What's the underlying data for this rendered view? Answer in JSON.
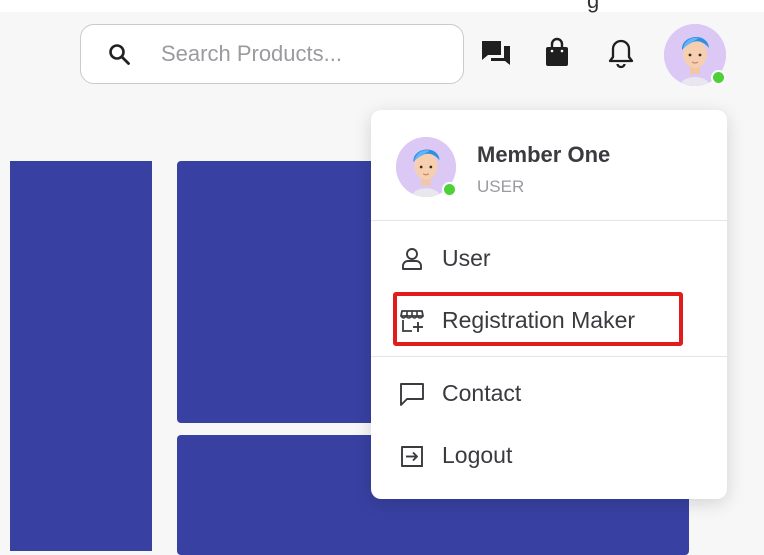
{
  "header": {
    "search": {
      "placeholder": "Search Products...",
      "value": ""
    },
    "top_partial_text": "g",
    "icons": [
      "search-icon",
      "chat-icon",
      "shopping-bag-icon",
      "bell-icon"
    ]
  },
  "user_menu": {
    "name": "Member One",
    "role": "USER",
    "items": [
      {
        "label": "User",
        "icon": "user-icon"
      },
      {
        "label": "Registration Maker",
        "icon": "store-add-icon"
      },
      {
        "label": "Contact",
        "icon": "message-square-icon"
      },
      {
        "label": "Logout",
        "icon": "logout-icon"
      }
    ],
    "highlighted_item": "Registration Maker"
  },
  "colors": {
    "background": "#f7f7f8",
    "tile_blue": "#3841a2",
    "online_status": "#4cd137",
    "highlight_red": "#e01c1c",
    "avatar_bg": "#dcc8f5"
  }
}
